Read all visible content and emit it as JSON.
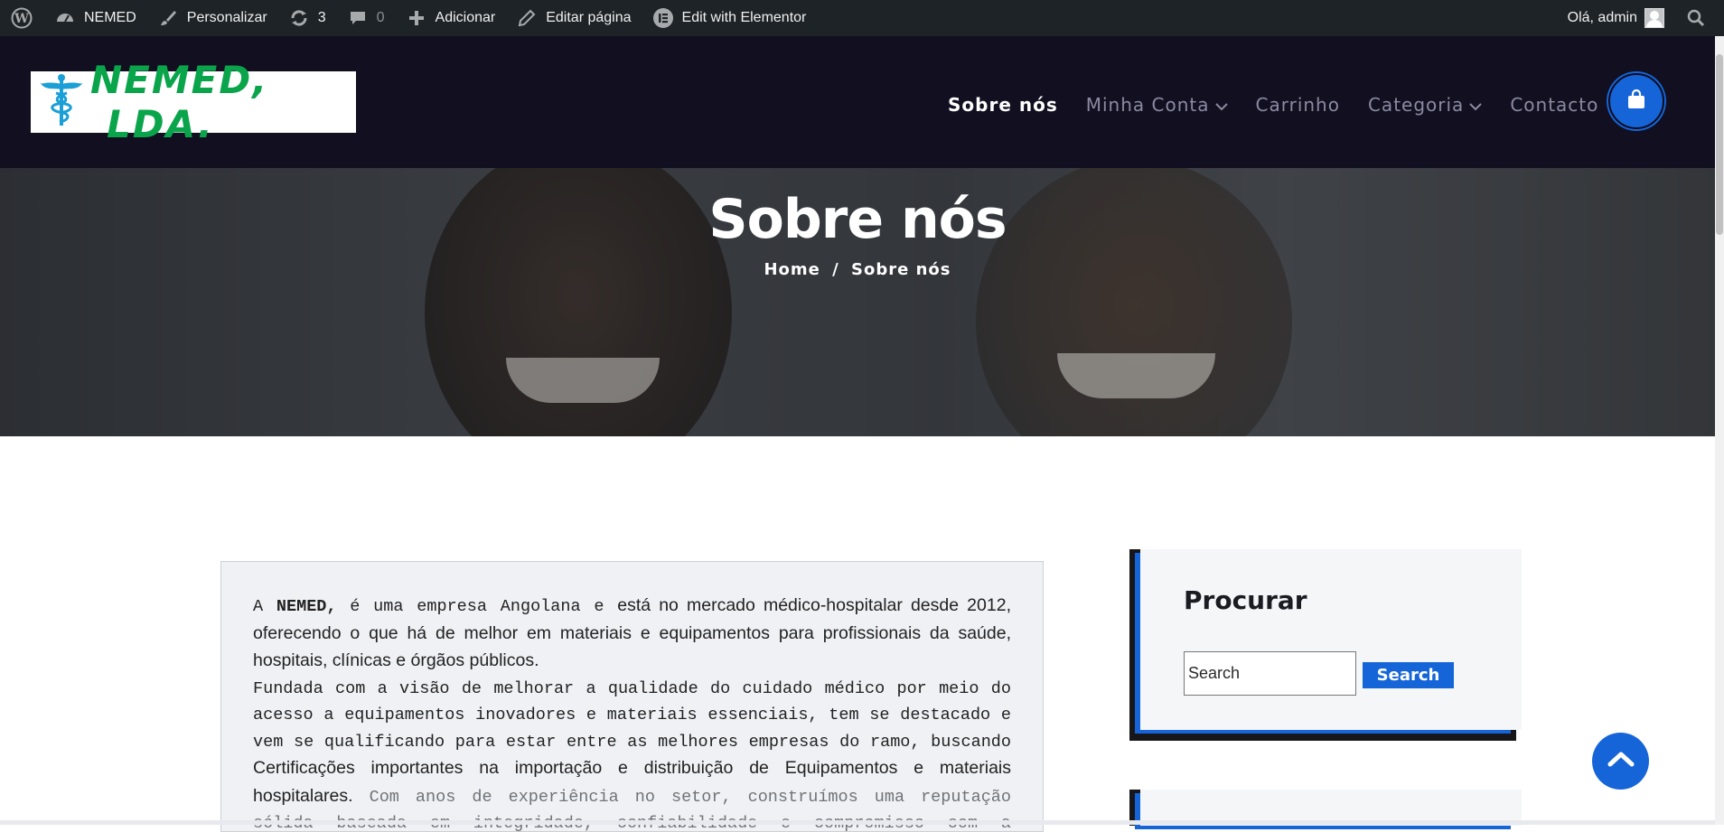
{
  "adminbar": {
    "site_name": "NEMED",
    "customize": "Personalizar",
    "updates_count": "3",
    "comments_count": "0",
    "add_new": "Adicionar",
    "edit_page": "Editar página",
    "elementor": "Edit with Elementor",
    "greeting": "Olá, admin"
  },
  "header": {
    "logo_text_a": "NEMED,",
    "logo_text_b": "LDA.",
    "nav": [
      {
        "label": "Sobre nós"
      },
      {
        "label": "Minha Conta"
      },
      {
        "label": "Carrinho"
      },
      {
        "label": "Categoria"
      },
      {
        "label": "Contacto"
      }
    ]
  },
  "hero": {
    "title": "Sobre nós",
    "breadcrumb_home": "Home",
    "breadcrumb_sep": "/",
    "breadcrumb_current": "Sobre nós"
  },
  "content": {
    "p1_a": "A ",
    "p1_brand": "NEMED,",
    "p1_b": " é uma empresa Angolana e ",
    "p1_c": "está no mercado médico-hospitalar desde 2012, oferecendo o que há de melhor em materiais e equipamentos para profissionais da saúde, hospitais, clínicas e órgãos públicos.",
    "p2_a": "Fundada com a visão de melhorar a qualidade do cuidado médico por meio do acesso a equipamentos inovadores e materiais essenciais,  tem se destacado e vem se qualificando para estar entre as melhores empresas do ramo, buscando ",
    "p2_b": "Certificações importantes na importação e  distribuição de Equipamentos e materiais hospitalares.",
    "p2_c": "  Com anos de experiência no setor, construímos uma reputação sólida baseada em integridade, confiabilidade e compromisso com a satisfação"
  },
  "sidebar": {
    "search_title": "Procurar",
    "search_placeholder": "Search",
    "search_button": "Search"
  },
  "colors": {
    "accent": "#1565d8",
    "header_bg": "#110f20",
    "adminbar_bg": "#1d2327"
  }
}
